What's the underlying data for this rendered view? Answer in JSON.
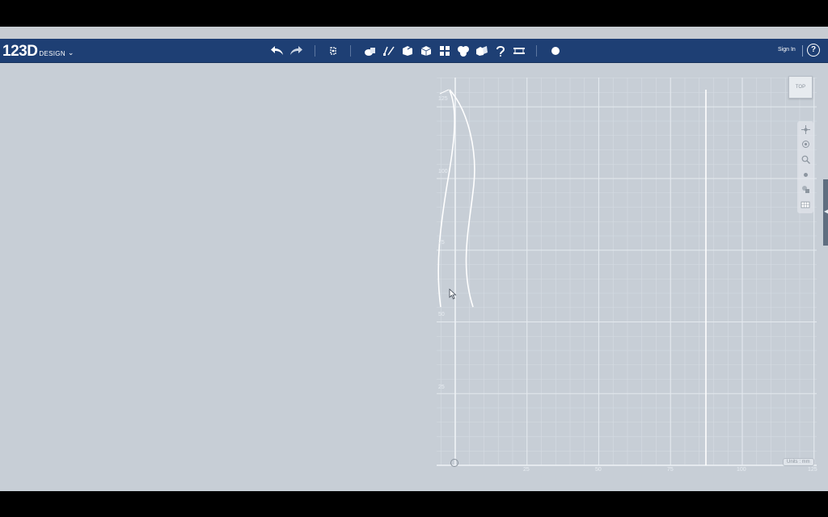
{
  "app": {
    "logo_main": "123D",
    "logo_sub": "DESIGN",
    "logo_caret": "⌄",
    "sign_in": "Sign In",
    "help_label": "?"
  },
  "toolbar": {
    "icons": [
      "undo-icon",
      "redo-icon",
      "transform-icon",
      "primitives-icon",
      "sketch-icon",
      "construct-icon",
      "modify-icon",
      "pattern-icon",
      "group-icon",
      "combine-icon",
      "snap-icon",
      "measure-icon",
      "material-icon"
    ]
  },
  "viewport": {
    "view_cube_label": "TOP",
    "units_label": "Units : mm",
    "x_ticks": [
      "25",
      "50",
      "75",
      "100",
      "125"
    ],
    "y_ticks": [
      "125",
      "100",
      "75",
      "50",
      "25"
    ],
    "nav_tools": [
      "pan-icon",
      "orbit-icon",
      "zoom-icon",
      "fit-icon",
      "view-mode-icon",
      "grid-toggle-icon"
    ]
  },
  "colors": {
    "appbar": "#1e3f74",
    "workspace": "#c7ced6",
    "grid_line": "#e4e9ee"
  }
}
